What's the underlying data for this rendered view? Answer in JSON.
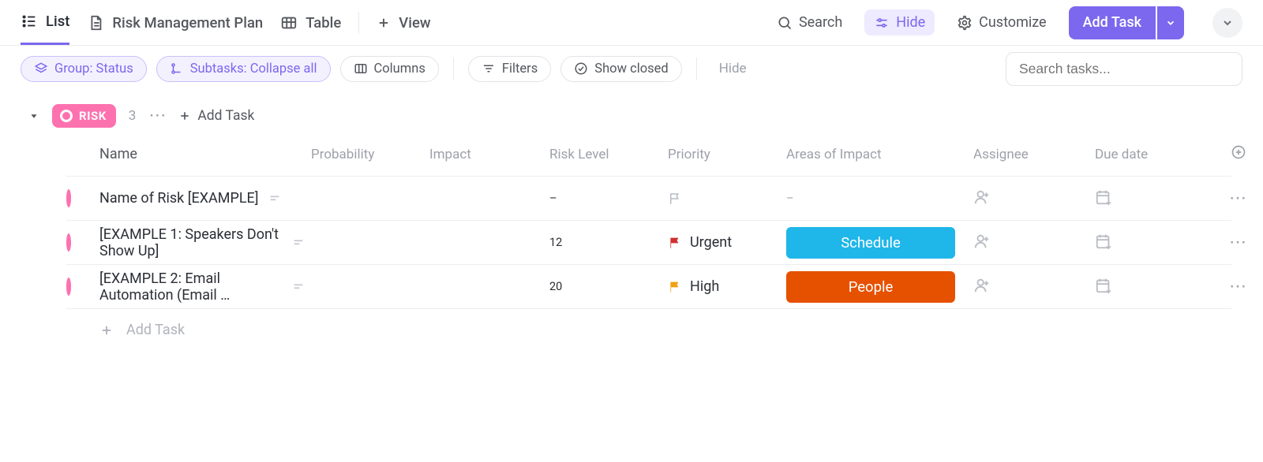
{
  "tabs": {
    "list": "List",
    "risk_plan": "Risk Management Plan",
    "table": "Table",
    "view": "View"
  },
  "top_right": {
    "search": "Search",
    "hide": "Hide",
    "customize": "Customize",
    "add_task": "Add Task"
  },
  "toolbar": {
    "group": "Group: Status",
    "subtasks": "Subtasks: Collapse all",
    "columns": "Columns",
    "filters": "Filters",
    "show_closed": "Show closed",
    "hide": "Hide",
    "search_placeholder": "Search tasks..."
  },
  "group": {
    "name": "RISK",
    "count": "3",
    "add_task": "Add Task"
  },
  "columns": {
    "name": "Name",
    "probability": "Probability",
    "impact": "Impact",
    "risk_level": "Risk Level",
    "priority": "Priority",
    "areas": "Areas of Impact",
    "assignee": "Assignee",
    "due": "Due date"
  },
  "rows": [
    {
      "name": "Name of Risk [EXAMPLE]",
      "probability": "",
      "impact": "",
      "risk_level": "–",
      "priority_label": "",
      "priority_flag": "gray",
      "area_label": "–",
      "area_tag": ""
    },
    {
      "name": "[EXAMPLE 1: Speakers Don't Show Up]",
      "probability": "",
      "impact": "",
      "risk_level": "12",
      "priority_label": "Urgent",
      "priority_flag": "red",
      "area_label": "Schedule",
      "area_tag": "schedule"
    },
    {
      "name": "[EXAMPLE 2: Email Automation (Email …",
      "probability": "",
      "impact": "",
      "risk_level": "20",
      "priority_label": "High",
      "priority_flag": "orange",
      "area_label": "People",
      "area_tag": "people"
    }
  ],
  "footer": {
    "add_task": "Add Task"
  }
}
